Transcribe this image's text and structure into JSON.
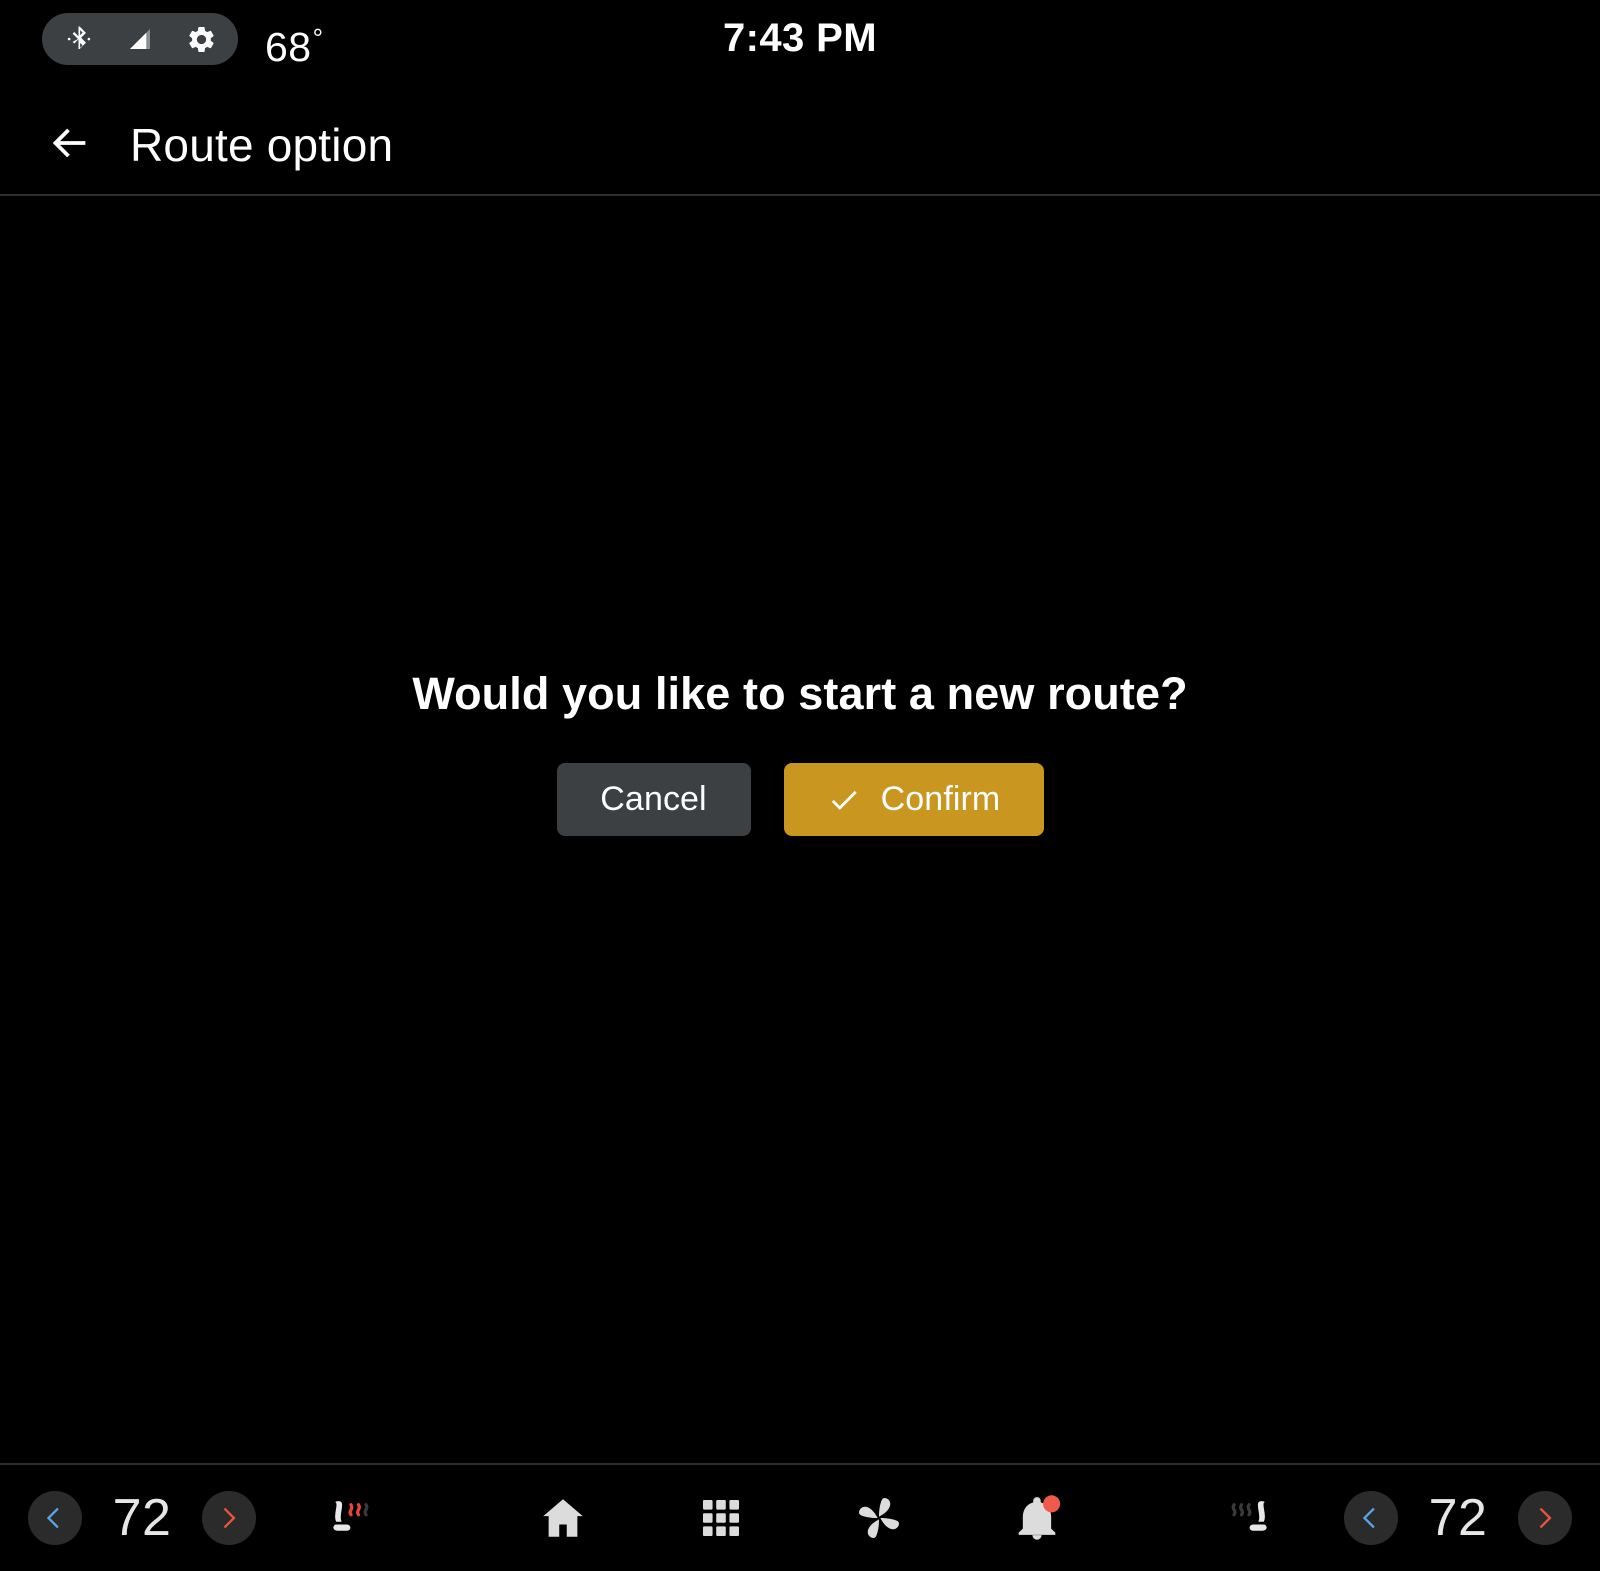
{
  "status_bar": {
    "icons": [
      "bluetooth-icon",
      "cell-signal-icon",
      "gear-icon"
    ],
    "outside_temp": "68",
    "degree_symbol": "°",
    "clock": "7:43 PM",
    "pill_color": "#3c4043"
  },
  "header": {
    "back_icon": "back-arrow-icon",
    "title": "Route option"
  },
  "dialog": {
    "message": "Would you like to start a new route?",
    "cancel_label": "Cancel",
    "confirm_label": "Confirm",
    "confirm_icon": "check-icon",
    "cancel_color": "#3c4043",
    "confirm_color": "#c9971f"
  },
  "bottom_bar": {
    "left_climate": {
      "decrease_icon": "chevron-left-icon",
      "temperature": "72",
      "increase_icon": "chevron-right-icon",
      "seat_icon": "heated-seat-icon",
      "seat_active": true
    },
    "right_climate": {
      "seat_icon": "heated-seat-icon",
      "seat_active": false,
      "decrease_icon": "chevron-left-icon",
      "temperature": "72",
      "increase_icon": "chevron-right-icon"
    },
    "nav_items": [
      {
        "icon": "home-icon",
        "label": "Home"
      },
      {
        "icon": "apps-grid-icon",
        "label": "Apps"
      },
      {
        "icon": "climate-fan-icon",
        "label": "Climate"
      },
      {
        "icon": "notification-bell-icon",
        "label": "Notifications",
        "badge": true
      }
    ],
    "colors": {
      "decrease_chevron": "#5ba4e8",
      "increase_chevron": "#e8553e",
      "circle_button": "#2b2b2b",
      "badge": "#ef5a4c",
      "heat_wave_active": "#e8443a",
      "heat_wave_inactive": "#3a3a3a"
    }
  }
}
